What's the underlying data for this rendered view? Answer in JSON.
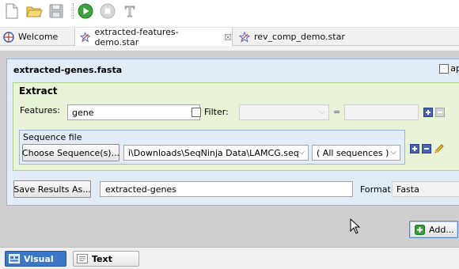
{
  "toolbar": {
    "icons": [
      "new-file-icon",
      "open-folder-icon",
      "save-disk-icon",
      "run-play-icon",
      "stop-icon",
      "text-icon"
    ]
  },
  "tabs": [
    {
      "label": "Welcome",
      "icon": "globe-icon"
    },
    {
      "label": "extracted-features-demo.star",
      "icon": "star-icon",
      "close": "☒"
    },
    {
      "label": "rev_comp_demo.star",
      "icon": "star-icon"
    }
  ],
  "panel": {
    "title": "extracted-genes.fasta",
    "app_checkbox_label": "app"
  },
  "extract": {
    "title": "Extract",
    "features_label": "Features:",
    "features_value": "gene",
    "filter_label": "Filter:",
    "filter_value": "",
    "equals": "=",
    "filter_text": ""
  },
  "sequence_file": {
    "title": "Sequence file",
    "choose_button": "Choose Sequence(s)...",
    "path_value": "i\\Downloads\\SeqNinja Data\\LAMCG.seq",
    "sequences_value": "( All sequences )"
  },
  "results": {
    "save_button": "Save Results As...",
    "filename": "extracted-genes",
    "format_label": "Format:",
    "format_value": "Fasta"
  },
  "add_button": "Add...",
  "bottom_tabs": [
    {
      "label": "Visual",
      "active": true
    },
    {
      "label": "Text",
      "active": false
    }
  ]
}
